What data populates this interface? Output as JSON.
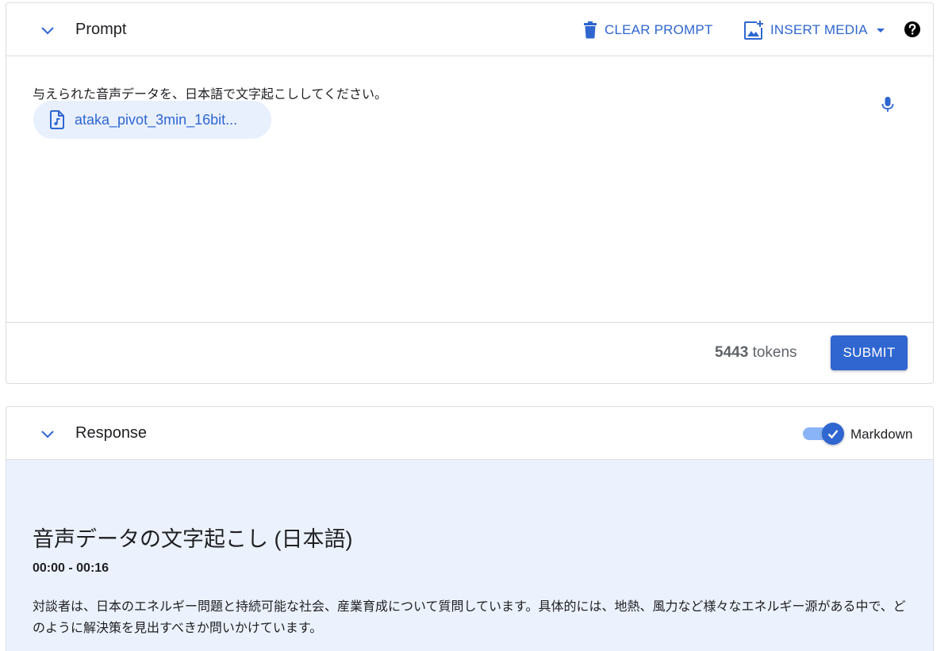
{
  "prompt": {
    "title": "Prompt",
    "clear_label": "CLEAR PROMPT",
    "insert_label": "INSERT MEDIA",
    "text": "与えられた音声データを、日本語で文字起こししてください。",
    "file_name": "ataka_pivot_3min_16bit...",
    "token_value": "5443",
    "token_unit": "tokens",
    "submit_label": "SUBMIT"
  },
  "response": {
    "title": "Response",
    "markdown_label": "Markdown",
    "markdown_enabled": true,
    "heading": "音声データの文字起こし (日本語)",
    "timestamp": "00:00 - 00:16",
    "paragraph": "対談者は、日本のエネルギー問題と持続可能な社会、産業育成について質問しています。具体的には、地熱、風力など様々なエネルギー源がある中で、どのように解決策を見出すべきか問いかけています。"
  },
  "colors": {
    "accent": "#2f66d0",
    "response_bg": "#ecf2fd",
    "chip_bg": "#e8f0fe",
    "border": "#dadce0"
  },
  "icons": {
    "collapse": "chevron-down-icon",
    "clear": "trash-icon",
    "insert": "add-image-icon",
    "dropdown": "caret-down-icon",
    "help": "help-icon",
    "file": "audio-file-icon",
    "mic": "microphone-icon",
    "check": "check-icon"
  }
}
